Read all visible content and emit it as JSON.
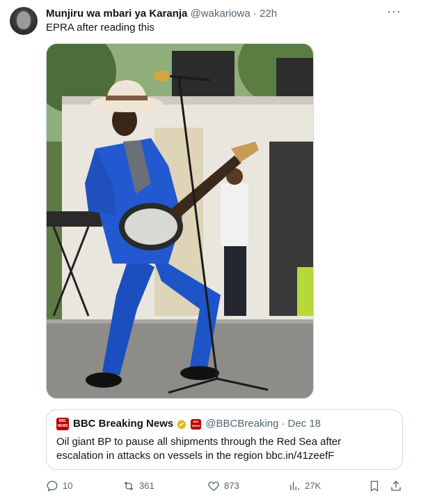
{
  "tweet": {
    "display_name": "Munjiru wa mbari ya Karanja",
    "handle": "@wakariowa",
    "separator": "·",
    "time": "22h",
    "more_icon": "more-dots-icon",
    "text": "EPRA after reading this",
    "media_icon": "photo-musician-guitar"
  },
  "quote": {
    "logo_text_top": "BBC",
    "logo_text_bottom": "NEWS",
    "display_name": "BBC Breaking News",
    "verified_color": "#e2b719",
    "handle": "@BBCBreaking",
    "separator": "·",
    "date": "Dec 18",
    "text": "Oil giant BP to pause all shipments through the Red Sea after escalation in attacks on vessels in the region bbc.in/41zeefF"
  },
  "actions": {
    "replies": "10",
    "retweets": "361",
    "likes": "873",
    "views": "27K"
  },
  "colors": {
    "text": "#0f1419",
    "muted": "#536471",
    "border": "#cfd9de",
    "bbc_red": "#b80000"
  }
}
